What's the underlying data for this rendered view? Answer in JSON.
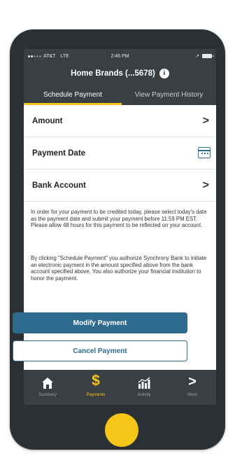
{
  "status_bar": {
    "carrier": "AT&T",
    "network": "LTE",
    "time": "2:46 PM"
  },
  "header": {
    "title": "Home Brands (...5678)",
    "info_icon": "info-icon"
  },
  "tabs": [
    {
      "label": "Schedule Payment",
      "active": true
    },
    {
      "label": "View Payment History",
      "active": false
    }
  ],
  "form": {
    "amount_label": "Amount",
    "payment_date_label": "Payment Date",
    "bank_account_label": "Bank Account"
  },
  "notice": {
    "paragraph1": "In order for your payment to be credited today, please select today's date as the payment date and submit your payment before 11:59 PM EST. Please allow 48 hours for this payment to be reflected on your account.",
    "paragraph2": "By clicking \"Schedule Payment\" you authorize Synchrony Bank to initiate an electronic payment in the amount specified above from the bank account specified above. You also authorize your financial institution to honor the payment."
  },
  "buttons": {
    "modify": "Modify Payment",
    "cancel": "Cancel Payment"
  },
  "tabbar": [
    {
      "label": "Summary",
      "icon": "home-icon",
      "active": false
    },
    {
      "label": "Payments",
      "icon": "dollar-icon",
      "active": true
    },
    {
      "label": "Activity",
      "icon": "chart-icon",
      "active": false
    },
    {
      "label": "More",
      "icon": "chevron-right-icon",
      "active": false
    }
  ],
  "colors": {
    "accent": "#f5c518",
    "primary": "#2e6a8e",
    "dark": "#3a3f44"
  }
}
